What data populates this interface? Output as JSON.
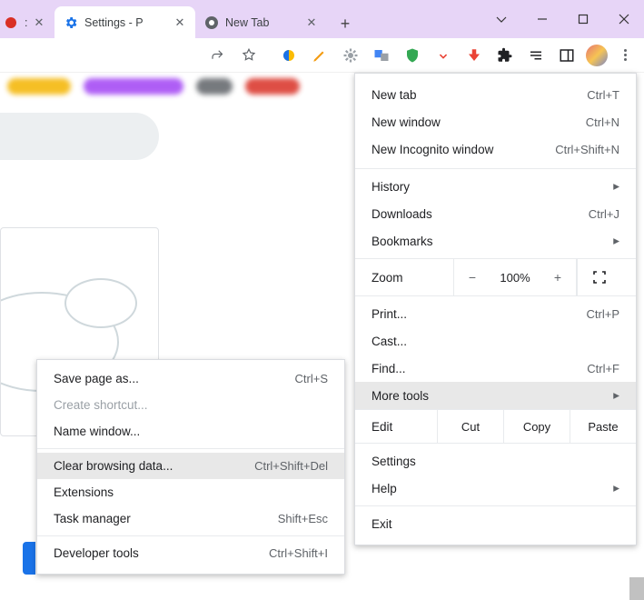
{
  "tabs": [
    {
      "title": ": Po",
      "favicon_color": "#d93025"
    },
    {
      "title": "Settings - P",
      "favicon_color": "#1a73e8",
      "active": true
    },
    {
      "title": "New Tab",
      "favicon_color": "#5f6368"
    }
  ],
  "main_menu": {
    "new_tab": {
      "label": "New tab",
      "shortcut": "Ctrl+T"
    },
    "new_window": {
      "label": "New window",
      "shortcut": "Ctrl+N"
    },
    "new_incognito": {
      "label": "New Incognito window",
      "shortcut": "Ctrl+Shift+N"
    },
    "history": {
      "label": "History"
    },
    "downloads": {
      "label": "Downloads",
      "shortcut": "Ctrl+J"
    },
    "bookmarks": {
      "label": "Bookmarks"
    },
    "zoom": {
      "label": "Zoom",
      "value": "100%",
      "minus": "−",
      "plus": "+"
    },
    "print": {
      "label": "Print...",
      "shortcut": "Ctrl+P"
    },
    "cast": {
      "label": "Cast..."
    },
    "find": {
      "label": "Find...",
      "shortcut": "Ctrl+F"
    },
    "more_tools": {
      "label": "More tools"
    },
    "edit": {
      "label": "Edit",
      "cut": "Cut",
      "copy": "Copy",
      "paste": "Paste"
    },
    "settings": {
      "label": "Settings"
    },
    "help": {
      "label": "Help"
    },
    "exit": {
      "label": "Exit"
    }
  },
  "sub_menu": {
    "save_page": {
      "label": "Save page as...",
      "shortcut": "Ctrl+S"
    },
    "create_shortcut": {
      "label": "Create shortcut..."
    },
    "name_window": {
      "label": "Name window..."
    },
    "clear_data": {
      "label": "Clear browsing data...",
      "shortcut": "Ctrl+Shift+Del"
    },
    "extensions": {
      "label": "Extensions"
    },
    "task_manager": {
      "label": "Task manager",
      "shortcut": "Shift+Esc"
    },
    "dev_tools": {
      "label": "Developer tools",
      "shortcut": "Ctrl+Shift+I"
    }
  }
}
